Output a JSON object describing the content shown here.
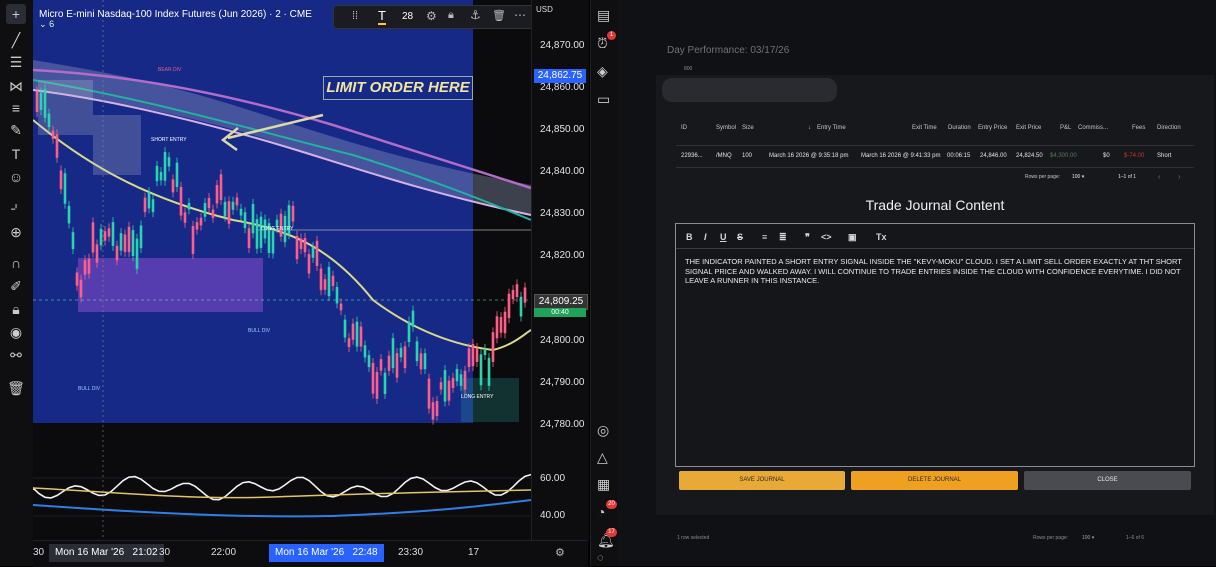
{
  "chart": {
    "symbol_title": "Micro E-mini Nasdaq-100 Index Futures (Jun 2026) · 2 · CME",
    "interval": "6",
    "annotation": "LIMIT ORDER HERE",
    "labels": {
      "short_entry": "SHORT ENTRY",
      "bear_div": "BEAR DIV",
      "bull_div_1": "BULL DIV",
      "bull_div_2": "BULL DIV",
      "long_entry_1": "LONG ENTRY",
      "long_entry_2": "LONG ENTRY"
    },
    "drawing_toolbar": {
      "font_size": "28"
    },
    "currency": "USD",
    "price_ticks": [
      "24,870.00",
      "24,860.00",
      "24,850.00",
      "24,840.00",
      "24,830.00",
      "24,820.00",
      "24,800.00",
      "24,790.00",
      "24,780.00"
    ],
    "last_price_badge": "24,862.75",
    "current_price_badge": "24,809.25",
    "small_badge": "00:40",
    "osc_ticks": [
      "60.00",
      "40.00"
    ],
    "time_ticks": [
      "30",
      "Mon 16 Mar '26",
      "21:02",
      "30",
      "22:00",
      "Mon 16 Mar '26",
      "22:48",
      "23:30",
      "17"
    ],
    "colors": {
      "accent_blue": "#2962ff",
      "selected_bg": "#1a2f9c",
      "green": "#26a69a",
      "red": "#ef5350",
      "purple_box": "#8a4fd0"
    }
  },
  "right_toolbar": {
    "alert_badge": "1",
    "notif_badge_1": "20",
    "notif_badge_2": "17"
  },
  "journal": {
    "header": "Day Performance: 03/17/26",
    "small_value": "800",
    "table": {
      "columns": [
        "ID",
        "Symbol",
        "Size",
        "Entry Time",
        "Exit Time",
        "Duration",
        "Entry Price",
        "Exit Price",
        "P&L",
        "Commiss...",
        "Fees",
        "Direction"
      ],
      "row": [
        "22936...",
        "/MNQ",
        "100",
        "March 16 2026 @ 9:35:18 pm",
        "March 16 2026 @ 9:41:33 pm",
        "00:06:15",
        "24,846.00",
        "24,824.50",
        "$4,300.00",
        "$0",
        "$-74.00",
        "Short"
      ],
      "rows_per_page_label": "Rows per page:",
      "rows_per_page_value": "100",
      "pagination": "1–1 of 1"
    },
    "content_title": "Trade Journal Content",
    "editor_tools": [
      "B",
      "I",
      "U",
      "S",
      "≡",
      "≣",
      "❞",
      "<>",
      "▣",
      "Tx"
    ],
    "body_text": "THE INDICATOR PAINTED A SHORT ENTRY SIGNAL INSIDE THE \"KEVY-MOKU\" CLOUD.  I SET A LIMIT SELL ORDER EXACTLY AT THT SHORT SIGNAL PRICE AND WALKED AWAY.   I WILL CONTINUE TO TRADE ENTRIES INSIDE THE CLOUD WITH CONFIDENCE EVERYTIME.   I DID NOT LEAVE A RUNNER IN THIS INSTANCE.",
    "buttons": {
      "save": "SAVE JOURNAL",
      "delete": "DELETE JOURNAL",
      "close": "CLOSE"
    },
    "footer": {
      "selected": "1 row selected",
      "rows_per_page_label": "Rows per page:",
      "rows_per_page_value": "100",
      "pagination": "1–6 of 6"
    }
  }
}
